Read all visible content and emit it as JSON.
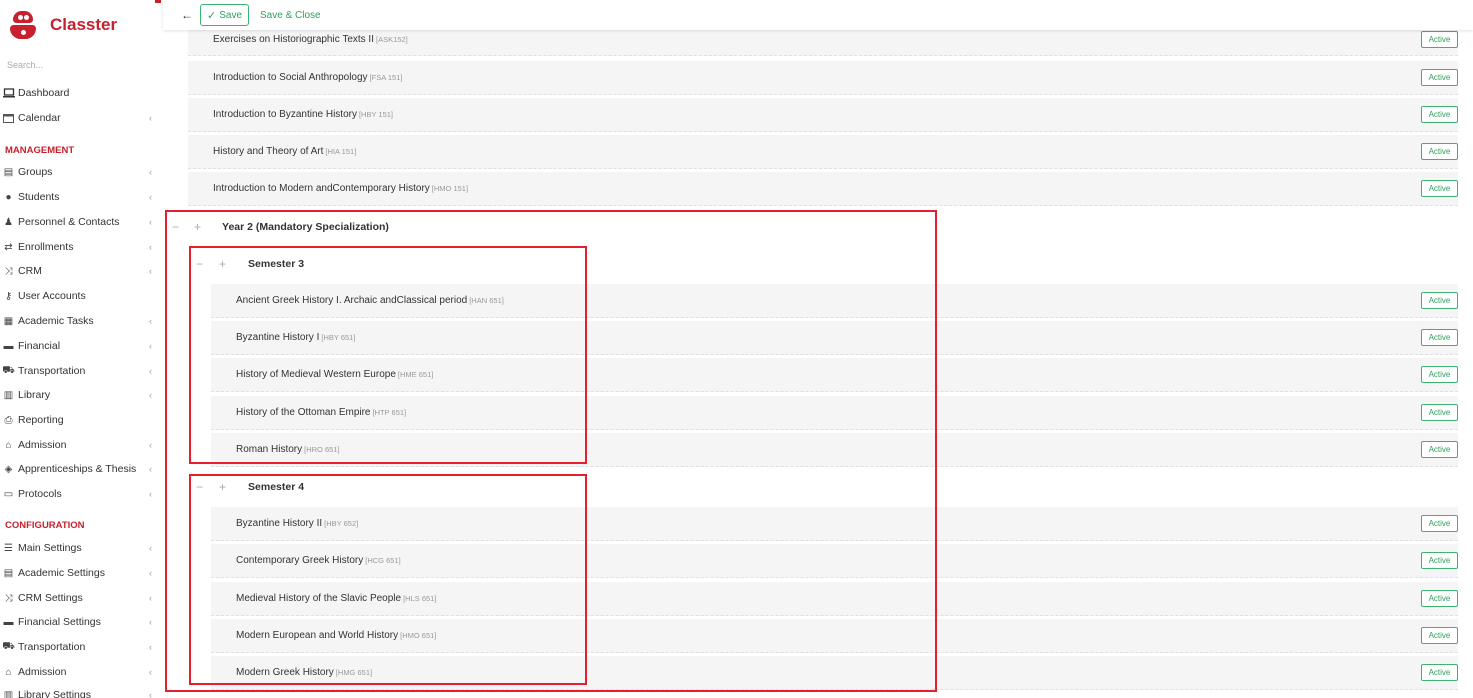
{
  "app": {
    "name": "Classter",
    "search_placeholder": "Search..."
  },
  "toolbar": {
    "save_label": "Save",
    "save_close_label": "Save & Close"
  },
  "sidebar": {
    "top_items": [
      {
        "label": "Dashboard",
        "icon": "laptop-icon"
      },
      {
        "label": "Calendar",
        "icon": "calendar-icon"
      }
    ],
    "management_heading": "MANAGEMENT",
    "management_items": [
      {
        "label": "Groups"
      },
      {
        "label": "Students"
      },
      {
        "label": "Personnel & Contacts"
      },
      {
        "label": "Enrollments"
      },
      {
        "label": "CRM"
      },
      {
        "label": "User Accounts"
      },
      {
        "label": "Academic Tasks"
      },
      {
        "label": "Financial"
      },
      {
        "label": "Transportation"
      },
      {
        "label": "Library"
      },
      {
        "label": "Reporting"
      },
      {
        "label": "Admission"
      },
      {
        "label": "Apprenticeships & Thesis"
      },
      {
        "label": "Protocols"
      }
    ],
    "configuration_heading": "CONFIGURATION",
    "configuration_items": [
      {
        "label": "Main Settings"
      },
      {
        "label": "Academic Settings"
      },
      {
        "label": "CRM Settings"
      },
      {
        "label": "Financial Settings"
      },
      {
        "label": "Transportation"
      },
      {
        "label": "Admission"
      },
      {
        "label": "Library Settings"
      }
    ]
  },
  "status_label": "Active",
  "courses_top": [
    {
      "name": "Exercises on Historiographic Texts II",
      "code": "[ASK152]"
    },
    {
      "name": "Introduction to Social Anthropology",
      "code": "[FSA 151]"
    },
    {
      "name": "Introduction to Byzantine History",
      "code": "[HBY 151]"
    },
    {
      "name": "History and Theory of Art",
      "code": "[HIA 151]"
    },
    {
      "name": "Introduction to Modern andContemporary History",
      "code": "[HMO 151]"
    }
  ],
  "year2": {
    "title": "Year 2 (Mandatory Specialization)"
  },
  "semester3": {
    "title": "Semester 3",
    "courses": [
      {
        "name": "Ancient Greek History I. Archaic andClassical period",
        "code": "[HAN 651]"
      },
      {
        "name": "Byzantine History I",
        "code": "[HBY 651]"
      },
      {
        "name": "History of Medieval Western Europe",
        "code": "[HME 651]"
      },
      {
        "name": "History of the Ottoman Empire",
        "code": "[HTP 651]"
      },
      {
        "name": "Roman History",
        "code": "[HRO 651]"
      }
    ]
  },
  "semester4": {
    "title": "Semester 4",
    "courses": [
      {
        "name": "Byzantine History II",
        "code": "[HBY 652]"
      },
      {
        "name": "Contemporary Greek History",
        "code": "[HCG 651]"
      },
      {
        "name": "Medieval History of the Slavic People",
        "code": "[HLS 651]"
      },
      {
        "name": "Modern European and World History",
        "code": "[HMO 651]"
      },
      {
        "name": "Modern Greek History",
        "code": "[HMG 651]"
      }
    ]
  },
  "colors": {
    "brand": "#c8202e",
    "accent_green": "#2e9e5e",
    "highlight": "#e4202e"
  }
}
